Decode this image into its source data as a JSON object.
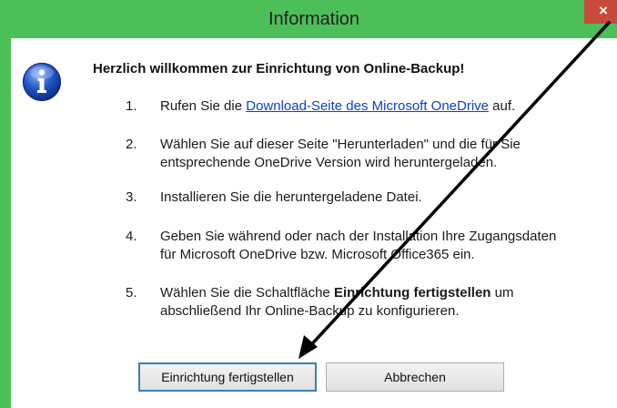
{
  "window": {
    "title": "Information",
    "close_glyph": "×",
    "accent_color": "#4dbf59",
    "close_color": "#c84a3c"
  },
  "dialog": {
    "icon": "info-icon",
    "heading": "Herzlich willkommen zur Einrichtung von Online-Backup!",
    "steps": [
      {
        "num": "1.",
        "pre": "Rufen Sie die ",
        "link": "Download-Seite des Microsoft OneDrive",
        "post": " auf."
      },
      {
        "num": "2.",
        "line1": "Wählen Sie auf dieser Seite \"Herunterladen\" und die für Sie",
        "line2": "entsprechende OneDrive Version wird heruntergeladen."
      },
      {
        "num": "3.",
        "line1": "Installieren Sie die heruntergeladene Datei."
      },
      {
        "num": "4.",
        "line1": "Geben Sie während oder nach der Installation Ihre Zugangsdaten",
        "line2": "für Microsoft OneDrive bzw. Microsoft Office365 ein."
      },
      {
        "num": "5.",
        "pre": "Wählen Sie die Schaltfläche ",
        "bold": "Einrichtung fertigstellen",
        "post": " um",
        "line2": "abschließend Ihr Online-Backup zu konfigurieren."
      }
    ]
  },
  "buttons": {
    "finish_label": "Einrichtung fertigstellen",
    "cancel_label": "Abbrechen"
  }
}
